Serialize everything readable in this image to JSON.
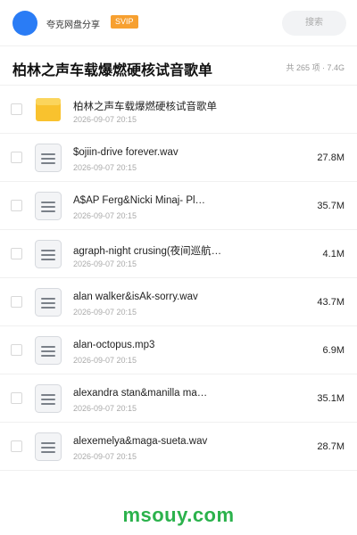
{
  "header": {
    "app_name": "夸克网盘分享",
    "badge": "SVIP",
    "search_placeholder": "搜索"
  },
  "folder": {
    "title": "柏林之声车载爆燃硬核试音歌单",
    "summary": "共 265 项 · 7.4G"
  },
  "files": [
    {
      "type": "folder",
      "name": "柏林之声车载爆燃硬核试音歌单",
      "date": "2026-09-07 20:15",
      "size": ""
    },
    {
      "type": "file",
      "name": "$ojiin-drive forever.wav",
      "date": "2026-09-07 20:15",
      "size": "27.8M"
    },
    {
      "type": "file",
      "name": "A$AP Ferg&Nicki Minaj- Pl…",
      "date": "2026-09-07 20:15",
      "size": "35.7M"
    },
    {
      "type": "file",
      "name": "agraph-night crusing(夜间巡航…",
      "date": "2026-09-07 20:15",
      "size": "4.1M"
    },
    {
      "type": "file",
      "name": "alan walker&isÁk-sorry.wav",
      "date": "2026-09-07 20:15",
      "size": "43.7M"
    },
    {
      "type": "file",
      "name": "alan-octopus.mp3",
      "date": "2026-09-07 20:15",
      "size": "6.9M"
    },
    {
      "type": "file",
      "name": "alexandra stan&manilla ma…",
      "date": "2026-09-07 20:15",
      "size": "35.1M"
    },
    {
      "type": "file",
      "name": "alexemelya&maga-sueta.wav",
      "date": "2026-09-07 20:15",
      "size": "28.7M"
    }
  ],
  "watermark": "msouy.com",
  "colors": {
    "avatar": "#2a7cf5",
    "svip": "#f7a030",
    "folder": "#f9c22e",
    "watermark": "#2bb24c"
  },
  "icons": {
    "folder": "folder-icon",
    "file": "document-icon"
  }
}
